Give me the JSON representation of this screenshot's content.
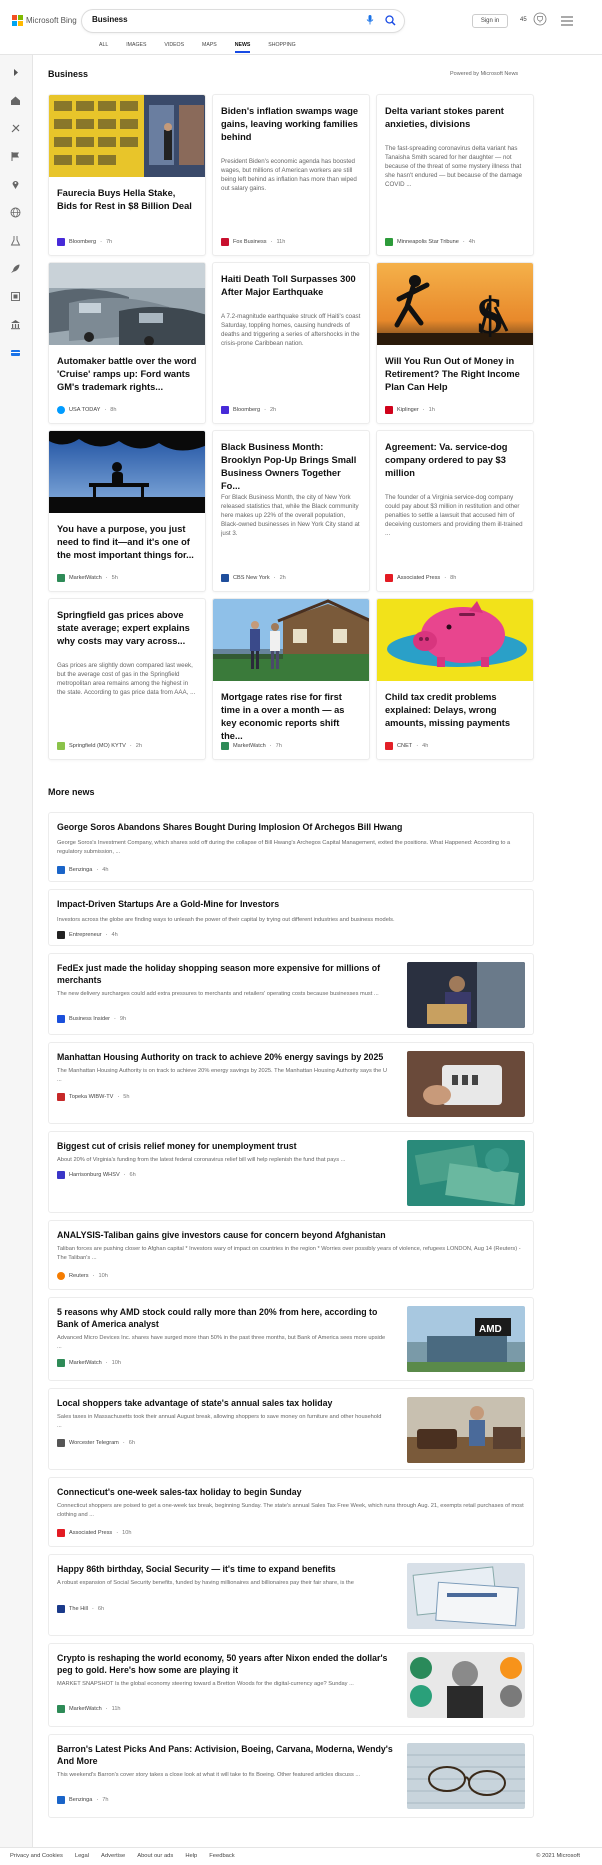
{
  "header": {
    "logo_text": "Microsoft Bing",
    "search_value": "Business",
    "signin_label": "Sign in",
    "rewards_count": "45",
    "tabs": [
      {
        "label": "ALL"
      },
      {
        "label": "IMAGES"
      },
      {
        "label": "VIDEOS"
      },
      {
        "label": "MAPS"
      },
      {
        "label": "NEWS"
      },
      {
        "label": "SHOPPING"
      }
    ],
    "active_tab": "NEWS"
  },
  "sidebar": {
    "icons": [
      "expand-icon",
      "home-icon",
      "sports-icon",
      "flag-icon",
      "location-icon",
      "globe-icon",
      "science-icon",
      "rocket-icon",
      "film-icon",
      "bank-icon",
      "business-icon"
    ]
  },
  "main": {
    "section_title": "Business",
    "powered_by": "Powered by Microsoft News",
    "cards": [
      {
        "title": "Faurecia Buys Hella Stake, Bids for Rest in $8 Billion Deal",
        "snippet": "",
        "source": "Bloomberg",
        "time": "7h",
        "source_color": "#472ad8",
        "image": "hella-store-image"
      },
      {
        "title": "Biden's inflation swamps wage gains, leaving working families behind",
        "snippet": "President Biden's economic agenda has boosted wages, but millions of American workers are still being left behind as inflation has more than wiped out salary gains.",
        "source": "Fox Business",
        "time": "11h",
        "source_color": "#c8102e",
        "image": ""
      },
      {
        "title": "Delta variant stokes parent anxieties, divisions",
        "snippet": "The fast-spreading coronavirus delta variant has Tanaisha Smith scared for her daughter — not because of the threat of some mystery illness that she hasn't endured — but because of the damage COVID ...",
        "source": "Minneapolis Star Tribune",
        "time": "4h",
        "source_color": "#2d9b3a",
        "image": ""
      },
      {
        "title": "Automaker battle over the word 'Cruise' ramps up: Ford wants GM's trademark rights...",
        "snippet": "",
        "source": "USA TODAY",
        "time": "8h",
        "source_color": "#009bff",
        "image": "parked-cars-image"
      },
      {
        "title": "Haiti Death Toll Surpasses 300 After Major Earthquake",
        "snippet": "A 7.2-magnitude earthquake struck off Haiti's coast Saturday, toppling homes, causing hundreds of deaths and triggering a series of aftershocks in the crisis-prone Caribbean nation.",
        "source": "Bloomberg",
        "time": "2h",
        "source_color": "#472ad8",
        "image": ""
      },
      {
        "title": "Will You Run Out of Money in Retirement? The Right Income Plan Can Help",
        "snippet": "",
        "source": "Kiplinger",
        "time": "1h",
        "source_color": "#d0021b",
        "image": "running-dollar-image"
      },
      {
        "title": "You have a purpose, you just need to find it—and it's one of the most important things for...",
        "snippet": "",
        "source": "MarketWatch",
        "time": "5h",
        "source_color": "#2e8b57",
        "image": "bench-silhouette-image"
      },
      {
        "title": "Black Business Month: Brooklyn Pop-Up Brings Small Business Owners Together Fo...",
        "snippet": "For Black Business Month, the city of New York released statistics that, while the Black community here makes up 22% of the overall population, Black-owned businesses in New York City stand at just 3.",
        "source": "CBS New York",
        "time": "2h",
        "source_color": "#1f4e9c",
        "image": ""
      },
      {
        "title": "Agreement: Va. service-dog company ordered to pay $3 million",
        "snippet": "The founder of a Virginia service-dog company could pay about $3 million in restitution and other penalties to settle a lawsuit that accused him of deceiving customers and providing them ill-trained ...",
        "source": "Associated Press",
        "time": "8h",
        "source_color": "#e31b23",
        "image": ""
      },
      {
        "title": "Springfield gas prices above state average; expert explains why costs may vary across...",
        "snippet": "Gas prices are slightly down compared last week, but the average cost of gas in the Springfield metropolitan area remains among the highest in the state. According to gas price data from AAA, ...",
        "source": "Springfield (MO) KYTV",
        "time": "2h",
        "source_color": "#8bc34a",
        "image": ""
      },
      {
        "title": "Mortgage rates rise for first time in a over a month — as key economic reports shift the...",
        "snippet": "",
        "source": "MarketWatch",
        "time": "7h",
        "source_color": "#2e8b57",
        "image": "couple-house-image"
      },
      {
        "title": "Child tax credit problems explained: Delays, wrong amounts, missing payments",
        "snippet": "",
        "source": "CNET",
        "time": "4h",
        "source_color": "#e22027",
        "image": "piggy-bank-image"
      }
    ],
    "more_title": "More news",
    "more_news": [
      {
        "title": "George Soros Abandons Shares Bought During Implosion Of Archegos Bill Hwang",
        "snippet": "George Soros's Investment Company, which shares sold off during the collapse of Bill Hwang's Archegos Capital Management, exited the positions. What Happened: According to a regulatory submission, ...",
        "source": "Benzinga",
        "time": "4h",
        "source_color": "#1a64c8",
        "thumb": ""
      },
      {
        "title": "Impact-Driven Startups Are a Gold-Mine for Investors",
        "snippet": "Investors across the globe are finding ways to unleash the power of their capital by trying out different industries and business models.",
        "source": "Entrepreneur",
        "time": "4h",
        "source_color": "#222222",
        "thumb": ""
      },
      {
        "title": "FedEx just made the holiday shopping season more expensive for millions of merchants",
        "snippet": "The new delivery surcharges could add extra pressures to merchants and retailers' operating costs because businesses must ...",
        "source": "Business Insider",
        "time": "9h",
        "source_color": "#1a4fdb",
        "thumb": "fedex-worker-thumb"
      },
      {
        "title": "Manhattan Housing Authority on track to achieve 20% energy savings by 2025",
        "snippet": "The Manhattan Housing Authority is on track to achieve 20% energy savings by 2025. The Manhattan Housing Authority says the U ...",
        "source": "Topeka WIBW-TV",
        "time": "5h",
        "source_color": "#c62828",
        "thumb": "thermostat-thumb"
      },
      {
        "title": "Biggest cut of crisis relief money for unemployment trust",
        "snippet": "About 20% of Virginia's funding from the latest federal coronavirus relief bill will help replenish the fund that pays ...",
        "source": "Harrisonburg WHSV",
        "time": "6h",
        "source_color": "#3a36c8",
        "thumb": "money-thumb"
      },
      {
        "title": "ANALYSIS-Taliban gains give investors cause for concern beyond Afghanistan",
        "snippet": "Taliban forces are pushing closer to Afghan capital * Investors wary of impact on countries in the region * Worries over possibly years of violence, refugees LONDON, Aug 14 (Reuters) - The Taliban's ...",
        "source": "Reuters",
        "time": "10h",
        "source_color": "#f57c00",
        "thumb": ""
      },
      {
        "title": "5 reasons why AMD stock could rally more than 20% from here, according to Bank of America analyst",
        "snippet": "Advanced Micro Devices Inc. shares have surged more than 50% in the past three months, but Bank of America sees more upside ...",
        "source": "MarketWatch",
        "time": "10h",
        "source_color": "#2e8b57",
        "thumb": "amd-building-thumb"
      },
      {
        "title": "Local shoppers take advantage of state's annual sales tax holiday",
        "snippet": "Sales taxes in Massachusetts took their annual August break, allowing shoppers to save money on furniture and other household ...",
        "source": "Worcester Telegram",
        "time": "6h",
        "source_color": "#555555",
        "thumb": "furniture-thumb"
      },
      {
        "title": "Connecticut's one-week sales-tax holiday to begin Sunday",
        "snippet": "Connecticut shoppers are poised to get a one-week tax break, beginning Sunday. The state's annual Sales Tax Free Week, which runs through Aug. 21, exempts retail purchases of most clothing and ...",
        "source": "Associated Press",
        "time": "10h",
        "source_color": "#e31b23",
        "thumb": ""
      },
      {
        "title": "Happy 86th birthday, Social Security — it's time to expand benefits",
        "snippet": "A robust expansion of Social Security benefits, funded by having millionaires and billionaires pay their fair share, is the",
        "source": "The Hill",
        "time": "6h",
        "source_color": "#1a3a8a",
        "thumb": "social-security-thumb"
      },
      {
        "title": "Crypto is reshaping the world economy, 50 years after Nixon ended the dollar's peg to gold. Here's how some are playing it",
        "snippet": "MARKET SNAPSHOT Is the global economy steering toward a Bretton Woods for the digital-currency age? Sunday ...",
        "source": "MarketWatch",
        "time": "11h",
        "source_color": "#2e8b57",
        "thumb": "nixon-crypto-thumb"
      },
      {
        "title": "Barron's Latest Picks And Pans: Activision, Boeing, Carvana, Moderna, Wendy's And More",
        "snippet": "This weekend's Barron's cover story takes a close look at what it will take to fix Boeing. Other featured articles discuss ...",
        "source": "Benzinga",
        "time": "7h",
        "source_color": "#1a64c8",
        "thumb": "glasses-chart-thumb"
      }
    ]
  },
  "footer": {
    "links": [
      "Privacy and Cookies",
      "Legal",
      "Advertise",
      "About our ads",
      "Help",
      "Feedback"
    ],
    "copyright": "© 2021 Microsoft"
  }
}
